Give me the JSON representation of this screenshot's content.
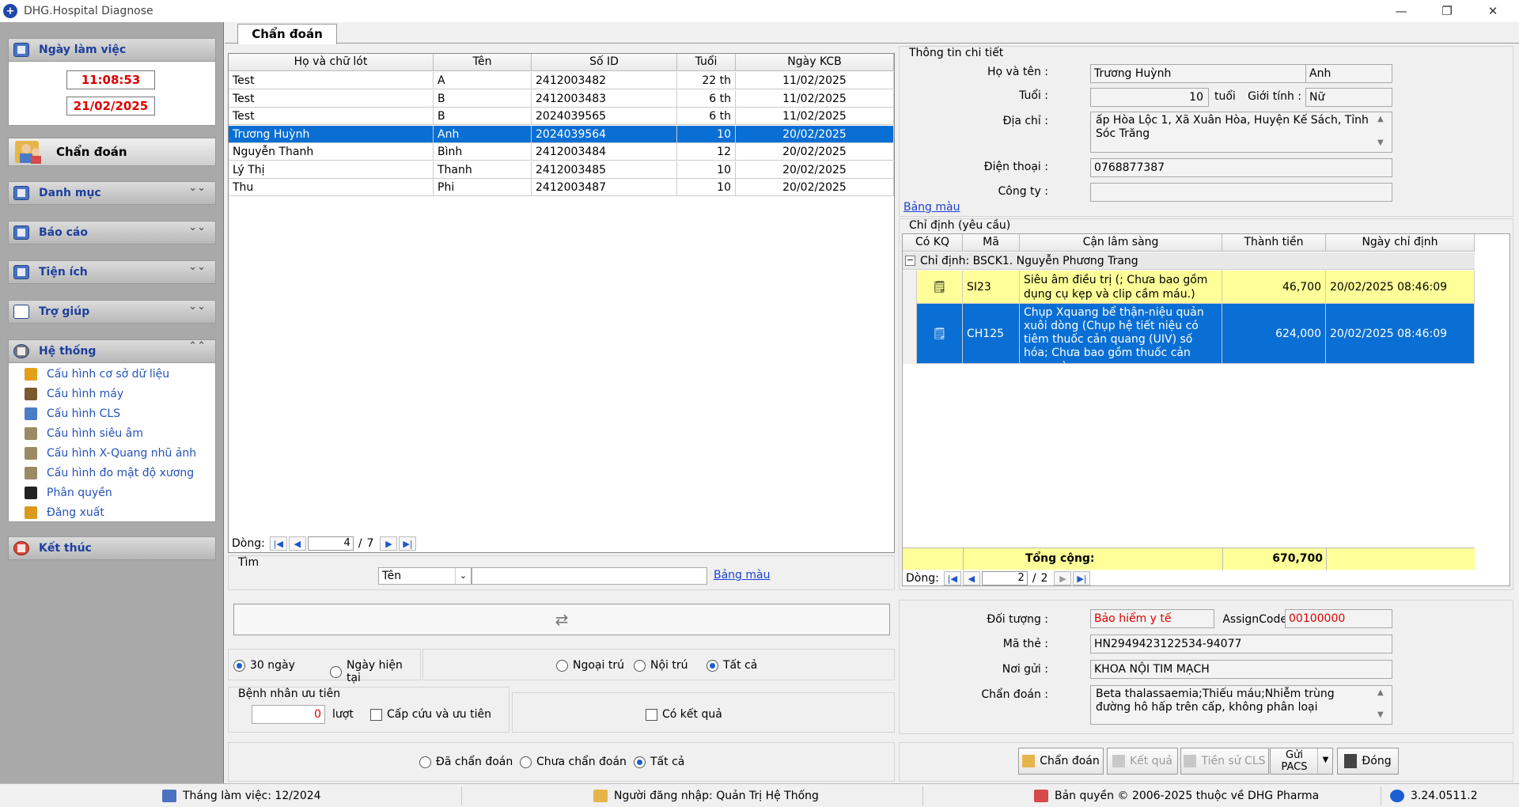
{
  "window": {
    "title": "DHG.Hospital Diagnose",
    "minimize": "—",
    "maximize": "❐",
    "close": "✕"
  },
  "sidebar": {
    "work_day_label": "Ngày làm việc",
    "time": "11:08:53",
    "date": "21/02/2025",
    "active_module": "Chẩn đoán",
    "menus": [
      {
        "label": "Danh mục",
        "chev": "⌄⌄"
      },
      {
        "label": "Báo cáo",
        "chev": "⌄⌄"
      },
      {
        "label": "Tiện ích",
        "chev": "⌄⌄"
      },
      {
        "label": "Trợ giúp",
        "chev": "⌄⌄"
      },
      {
        "label": "Hệ thống",
        "chev": "⌃⌃"
      }
    ],
    "system_items": [
      {
        "label": "Cấu hình cơ sở dữ liệu",
        "icon": "database-icon",
        "color": "#e2a01a"
      },
      {
        "label": "Cấu hình máy",
        "icon": "tools-icon",
        "color": "#7b5a2f"
      },
      {
        "label": "Cấu hình CLS",
        "icon": "cls-icon",
        "color": "#4a7ec4"
      },
      {
        "label": "Cấu hình siêu âm",
        "icon": "ultrasound-icon",
        "color": "#9a8a66"
      },
      {
        "label": "Cấu hình X-Quang nhũ ảnh",
        "icon": "xray-icon",
        "color": "#9a8a66"
      },
      {
        "label": "Cấu hình đo mật độ xương",
        "icon": "bone-icon",
        "color": "#9a8a66"
      },
      {
        "label": "Phân quyền",
        "icon": "lock-icon",
        "color": "#222222"
      },
      {
        "label": "Đăng xuất",
        "icon": "key-icon",
        "color": "#d99a1c"
      }
    ],
    "exit_label": "Kết thúc"
  },
  "tab": {
    "label": "Chẩn đoán"
  },
  "patients": {
    "columns": [
      "Họ và chữ lót",
      "Tên",
      "Số ID",
      "Tuổi",
      "Ngày KCB"
    ],
    "rows": [
      [
        "Test",
        "A",
        "2412003482",
        "22 th",
        "11/02/2025"
      ],
      [
        "Test",
        "B",
        "2412003483",
        "6 th",
        "11/02/2025"
      ],
      [
        "Test",
        "B",
        "2024039565",
        "6 th",
        "11/02/2025"
      ],
      [
        "Trương Huỳnh",
        "Anh",
        "2024039564",
        "10",
        "20/02/2025"
      ],
      [
        "Nguyễn Thanh",
        "Bình",
        "2412003484",
        "12",
        "20/02/2025"
      ],
      [
        "Lý Thị",
        "Thanh",
        "2412003485",
        "10",
        "20/02/2025"
      ],
      [
        "Thu",
        "Phi",
        "2412003487",
        "10",
        "20/02/2025"
      ]
    ],
    "selected_row": 3,
    "nav_label": "Dòng:",
    "current": "4",
    "total": "7"
  },
  "search": {
    "label": "Tìm",
    "field_value": "Tên",
    "input_value": "",
    "color_link": "Bảng màu"
  },
  "filters": {
    "range": [
      {
        "label": "30 ngày",
        "checked": true
      },
      {
        "label": "Ngày hiện tại",
        "checked": false
      }
    ],
    "type": [
      {
        "label": "Ngoại trú",
        "checked": false
      },
      {
        "label": "Nội trú",
        "checked": false
      },
      {
        "label": "Tất cả",
        "checked": true
      }
    ],
    "priority_title": "Bệnh nhân ưu tiên",
    "priority_count": "0",
    "priority_unit": "lượt",
    "emergency_label": "Cấp cứu và ưu tiên",
    "has_result_label": "Có kết quả",
    "diag": [
      {
        "label": "Đã chẩn đoán",
        "checked": false
      },
      {
        "label": "Chưa chẩn đoán",
        "checked": false
      },
      {
        "label": "Tất cả",
        "checked": true
      }
    ]
  },
  "detail": {
    "title": "Thông tin chi tiết",
    "name_label": "Họ và tên :",
    "last_name": "Trương Huỳnh",
    "first_name": "Anh",
    "age_label": "Tuổi :",
    "age": "10",
    "age_unit": "tuổi",
    "gender_label": "Giới tính :",
    "gender": "Nữ",
    "address_label": "Địa chỉ :",
    "address": "ấp Hòa Lộc 1, Xã Xuân Hòa, Huyện Kế Sách, Tỉnh Sóc Trăng",
    "phone_label": "Điện thoại :",
    "phone": "0768877387",
    "company_label": "Công ty :",
    "company": "",
    "color_link": "Bảng màu"
  },
  "orders": {
    "title": "Chỉ định (yêu cầu)",
    "columns": [
      "Có KQ",
      "Mã",
      "Cận lâm sàng",
      "Thành tiền",
      "Ngày chỉ định"
    ],
    "group_label": "Chỉ định:  BSCK1. Nguyễn Phương Trang",
    "rows": [
      {
        "code": "SI23",
        "name": "Siêu âm điều trị (; Chưa bao gồm dụng cụ kẹp và clip cầm máu.)",
        "amount": "46,700",
        "date": "20/02/2025 08:46:09"
      },
      {
        "code": "CH125",
        "name": "Chụp Xquang bể thận-niệu quản xuôi dòng (Chụp hệ tiết niệu có tiêm thuốc cản quang (UIV) số hóa; Chưa bao gồm thuốc cản quang.)",
        "amount": "624,000",
        "date": "20/02/2025 08:46:09"
      }
    ],
    "total_label": "Tổng cộng:",
    "total": "670,700",
    "nav_label": "Dòng:",
    "current": "2",
    "total_pages": "2"
  },
  "insurance": {
    "object_label": "Đối tượng :",
    "object": "Bảo hiểm y tế",
    "assign_label": "AssignCode",
    "assign": "00100000",
    "card_label": "Mã thẻ :",
    "card": "HN2949423122534-94077",
    "sender_label": "Nơi gửi :",
    "sender": "KHOA NỘI TIM MẠCH",
    "diag_label": "Chẩn đoán :",
    "diag": "Beta thalassaemia;Thiếu máu;Nhiễm trùng đường hô hấp trên cấp, không phân loại"
  },
  "buttons": {
    "diagnose": "Chẩn đoán",
    "result": "Kết quả",
    "history": "Tiền sử CLS",
    "pacs_line1": "Gửi",
    "pacs_line2": "PACS",
    "close": "Đóng"
  },
  "status": {
    "month": "Tháng làm việc: 12/2024",
    "user": "Người đăng nhập: Quản Trị Hệ Thống",
    "copyright": "Bản quyền © 2006-2025 thuộc về DHG Pharma",
    "version": "3.24.0511.2"
  },
  "colors": {
    "selection": "#0a6fd4",
    "highlight_row": "#ffff99",
    "link": "#1b3fd1",
    "alert": "#dd0000"
  }
}
